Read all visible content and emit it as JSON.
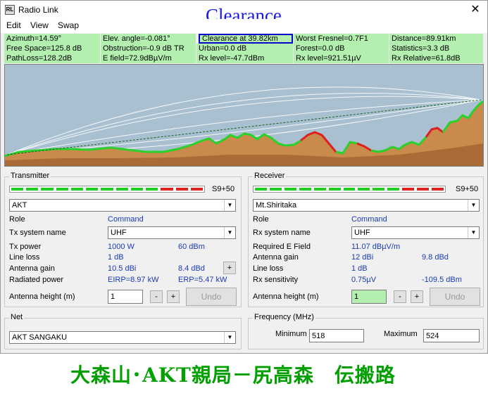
{
  "window": {
    "title": "Radio Link",
    "overlay_title": "Clearance",
    "app_icon": "RL",
    "close_icon": "✕"
  },
  "menu": [
    "Edit",
    "View",
    "Swap"
  ],
  "stats": [
    [
      "Azimuth=14.59°",
      "Elev. angle=-0.081°",
      "Clearance at 39.82km",
      "Worst Fresnel=0.7F1",
      "Distance=89.91km"
    ],
    [
      "Free Space=125.8 dB",
      "Obstruction=-0.9 dB TR",
      "Urban=0.0 dB",
      "Forest=0.0 dB",
      "Statistics=3.3 dB"
    ],
    [
      "PathLoss=128.2dB",
      "E field=72.9dBµV/m",
      "Rx level=-47.7dBm",
      "Rx level=921.51µV",
      "Rx Relative=61.8dB"
    ]
  ],
  "transmitter": {
    "title": "Transmitter",
    "meter_label": "S9+50",
    "site": "AKT",
    "role_label": "Role",
    "role_value": "Command",
    "system_label": "Tx system name",
    "system_value": "UHF",
    "power_label": "Tx power",
    "power_w": "1000 W",
    "power_dbm": "60 dBm",
    "line_loss_label": "Line loss",
    "line_loss": "1 dB",
    "gain_label": "Antenna gain",
    "gain_dbi": "10.5 dBi",
    "gain_dbd": "8.4 dBd",
    "radiated_label": "Radiated power",
    "eirp": "EIRP=8.97 kW",
    "erp": "ERP=5.47 kW",
    "height_label": "Antenna height (m)",
    "height": "1",
    "minus": "-",
    "plus": "+",
    "undo": "Undo"
  },
  "receiver": {
    "title": "Receiver",
    "meter_label": "S9+50",
    "site": "Mt.Shiritaka",
    "role_label": "Role",
    "role_value": "Command",
    "system_label": "Rx system name",
    "system_value": "UHF",
    "field_label": "Required E Field",
    "field_value": "11.07 dBµV/m",
    "gain_label": "Antenna gain",
    "gain_dbi": "12 dBi",
    "gain_dbd": "9.8 dBd",
    "line_loss_label": "Line loss",
    "line_loss": "1 dB",
    "sens_label": "Rx sensitivity",
    "sens_uv": "0.75µV",
    "sens_dbm": "-109.5 dBm",
    "height_label": "Antenna height (m)",
    "height": "1",
    "minus": "-",
    "plus": "+",
    "undo": "Undo"
  },
  "net": {
    "title": "Net",
    "value": "AKT SANGAKU"
  },
  "frequency": {
    "title": "Frequency (MHz)",
    "min_label": "Minimum",
    "min": "518",
    "max_label": "Maximum",
    "max": "524"
  },
  "caption": "大森山･AKT親局－尻高森　伝搬路",
  "meter": {
    "segments": 13,
    "green_segments": 10,
    "green": "#22cc22",
    "red": "#dd2222"
  }
}
